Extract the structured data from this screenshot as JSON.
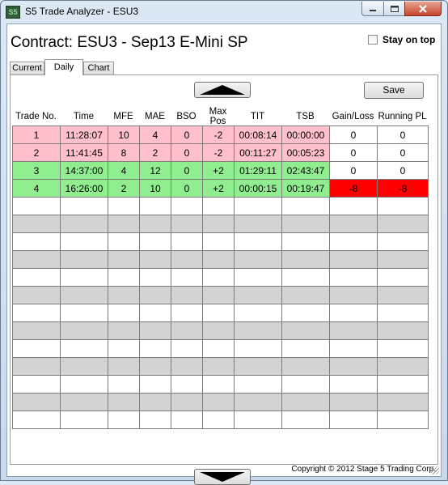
{
  "window": {
    "title": "S5 Trade Analyzer - ESU3",
    "icon_text": "S5"
  },
  "header": {
    "contract": "Contract: ESU3 - Sep13 E-Mini SP",
    "stay_on_top_label": "Stay on top",
    "stay_on_top_checked": false
  },
  "tabs": [
    {
      "label": "Current"
    },
    {
      "label": "Daily",
      "selected": true
    },
    {
      "label": "Chart"
    }
  ],
  "toolbar": {
    "save_label": "Save"
  },
  "columns": [
    "Trade No.",
    "Time",
    "MFE",
    "MAE",
    "BSO",
    "Max Pos",
    "TIT",
    "TSB",
    "Gain/Loss",
    "Running PL"
  ],
  "rows": [
    {
      "cells": [
        "1",
        "11:28:07",
        "10",
        "4",
        "0",
        "-2",
        "00:08:14",
        "00:00:00",
        "0",
        "0"
      ],
      "color": "pink"
    },
    {
      "cells": [
        "2",
        "11:41:45",
        "8",
        "2",
        "0",
        "-2",
        "00:11:27",
        "00:05:23",
        "0",
        "0"
      ],
      "color": "pink"
    },
    {
      "cells": [
        "3",
        "14:37:00",
        "4",
        "12",
        "0",
        "+2",
        "01:29:11",
        "02:43:47",
        "0",
        "0"
      ],
      "color": "green"
    },
    {
      "cells": [
        "4",
        "16:26:00",
        "2",
        "10",
        "0",
        "+2",
        "00:00:15",
        "00:19:47",
        "-8",
        "-8"
      ],
      "color": "green",
      "pl_color": "red"
    }
  ],
  "empty_row_count": 13,
  "colors": {
    "pink": "#ffc0cb",
    "green": "#90ee90",
    "red": "#ff0000",
    "gray": "#d3d3d3",
    "white": "#ffffff"
  },
  "footer": {
    "copyright": "Copyright © 2012 Stage 5 Trading Corp."
  }
}
